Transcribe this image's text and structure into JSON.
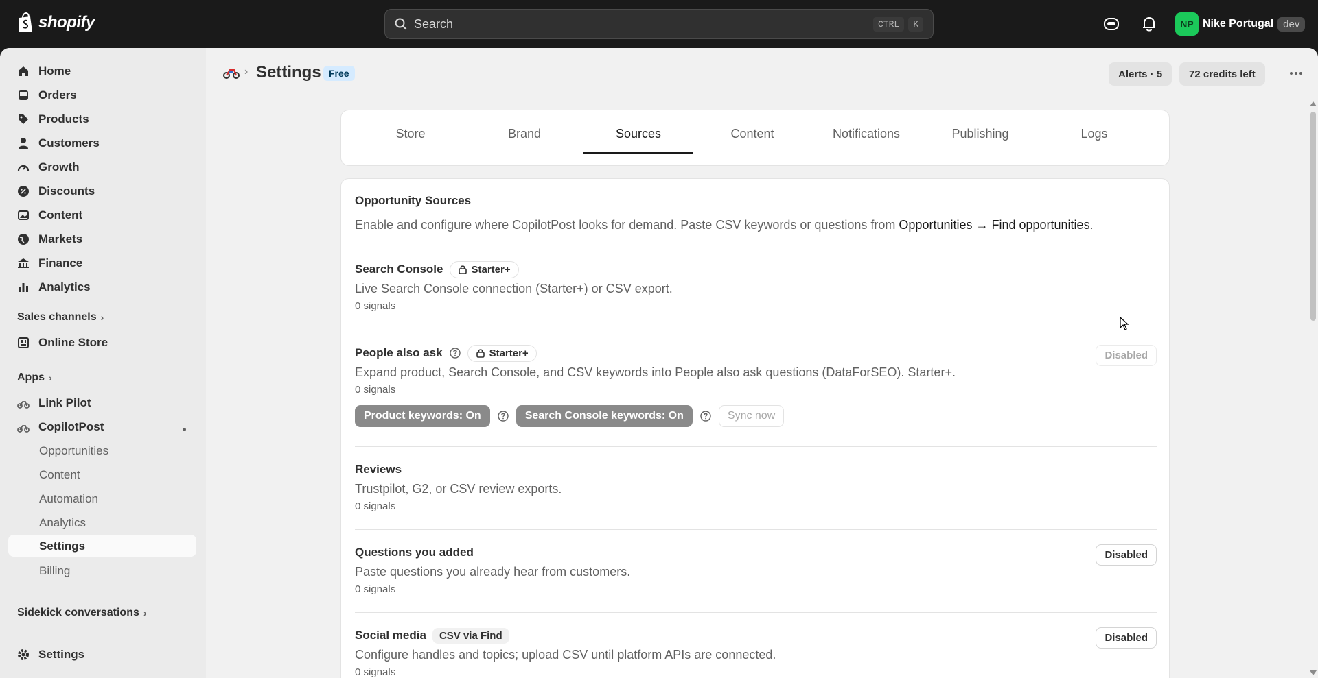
{
  "topbar": {
    "logo_text": "shopify",
    "search_placeholder": "Search",
    "shortcut_ctrl": "CTRL",
    "shortcut_key": "K",
    "avatar_initials": "NP",
    "store_name": "Nike Portugal",
    "env_badge": "dev"
  },
  "sidebar": {
    "items": [
      {
        "label": "Home",
        "icon": "home-icon"
      },
      {
        "label": "Orders",
        "icon": "inbox-icon"
      },
      {
        "label": "Products",
        "icon": "tag-icon"
      },
      {
        "label": "Customers",
        "icon": "person-icon"
      },
      {
        "label": "Growth",
        "icon": "gauge-icon"
      },
      {
        "label": "Discounts",
        "icon": "discount-icon"
      },
      {
        "label": "Content",
        "icon": "image-icon"
      },
      {
        "label": "Markets",
        "icon": "globe-icon"
      },
      {
        "label": "Finance",
        "icon": "bank-icon"
      },
      {
        "label": "Analytics",
        "icon": "bar-chart-icon"
      }
    ],
    "sales_channels_label": "Sales channels",
    "online_store_label": "Online Store",
    "apps_label": "Apps",
    "link_pilot_label": "Link Pilot",
    "copilotpost_label": "CopilotPost",
    "sub_items": [
      "Opportunities",
      "Content",
      "Automation",
      "Analytics",
      "Settings",
      "Billing"
    ],
    "sidekick_label": "Sidekick conversations",
    "settings_label": "Settings"
  },
  "header": {
    "title": "Settings",
    "plan_badge": "Free",
    "alerts_label": "Alerts · 5",
    "credits_label": "72 credits left"
  },
  "tabs": [
    "Store",
    "Brand",
    "Sources",
    "Content",
    "Notifications",
    "Publishing",
    "Logs"
  ],
  "active_tab": "Sources",
  "sources": {
    "title": "Opportunity Sources",
    "desc_prefix": "Enable and configure where CopilotPost looks for demand. Paste CSV keywords or questions from ",
    "desc_link": "Opportunities → Find opportunities",
    "desc_suffix": ".",
    "search_console": {
      "name": "Search Console",
      "tier": "Starter+",
      "desc": "Live Search Console connection (Starter+) or CSV export.",
      "signals": "0 signals"
    },
    "people_also_ask": {
      "name": "People also ask",
      "tier": "Starter+",
      "desc": "Expand product, Search Console, and CSV keywords into People also ask questions (DataForSEO). Starter+.",
      "signals": "0 signals",
      "status": "Disabled",
      "product_toggle": "Product keywords: On",
      "console_toggle": "Search Console keywords: On",
      "sync_label": "Sync now"
    },
    "reviews": {
      "name": "Reviews",
      "desc": "Trustpilot, G2, or CSV review exports.",
      "signals": "0 signals"
    },
    "questions": {
      "name": "Questions you added",
      "desc": "Paste questions you already hear from customers.",
      "signals": "0 signals",
      "status": "Disabled"
    },
    "social": {
      "name": "Social media",
      "badge": "CSV via Find",
      "desc": "Configure handles and topics; upload CSV until platform APIs are connected.",
      "signals": "0 signals",
      "status": "Disabled"
    }
  },
  "colors": {
    "topbar_bg": "#1a1a1a",
    "avatar_bg": "#1bc95a",
    "free_badge_bg": "#d5ebff",
    "toggle_pill_bg": "#8a8a8a"
  }
}
